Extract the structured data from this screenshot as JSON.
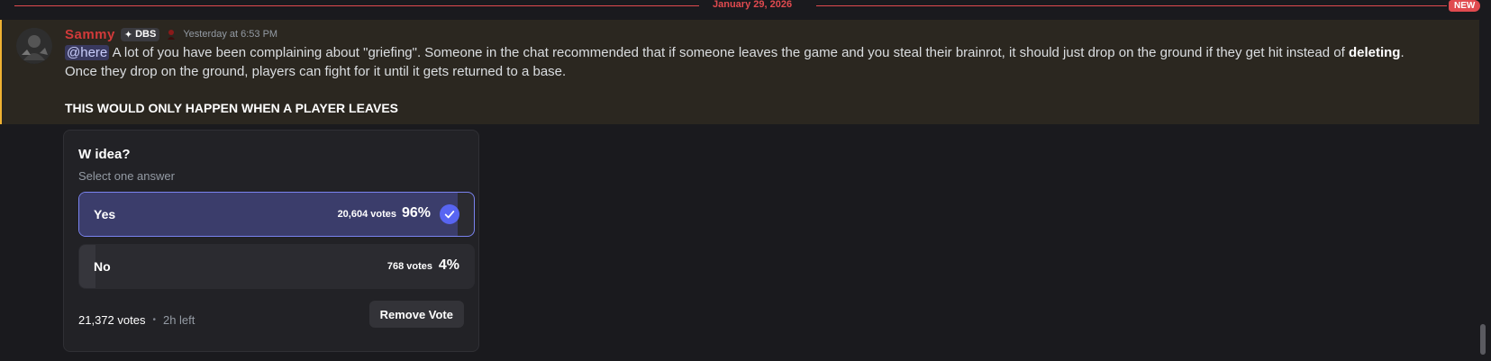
{
  "divider": {
    "date": "January 29, 2026",
    "new_badge": "NEW"
  },
  "message": {
    "author": "Sammy",
    "guild_tag": "DBS",
    "timestamp": "Yesterday at 6:53 PM",
    "mention": "@here",
    "text_before_bold": " A lot of you have been complaining about \"griefing\". Someone in the chat recommended that if someone leaves the game and you steal their brainrot, it should just drop on the ground if they get hit instead of ",
    "bold": "deleting",
    "text_after_bold": ".",
    "line2": "Once they drop on the ground, players can fight for it until it gets returned to a base.",
    "shout": "THIS WOULD ONLY HAPPEN WHEN A PLAYER LEAVES",
    "colors": {
      "author": "#d23a3a",
      "highlight_bar": "#f0b232",
      "mention_bg": "#5865f2"
    }
  },
  "poll": {
    "question": "W idea?",
    "subtitle": "Select one answer",
    "answers": [
      {
        "label": "Yes",
        "votes": "20,604 votes",
        "percent": "96%",
        "fraction": 0.96,
        "selected": true
      },
      {
        "label": "No",
        "votes": "768 votes",
        "percent": "4%",
        "fraction": 0.04,
        "selected": false
      }
    ],
    "total_votes": "21,372 votes",
    "time_left": "2h left",
    "remove_vote_label": "Remove Vote"
  }
}
